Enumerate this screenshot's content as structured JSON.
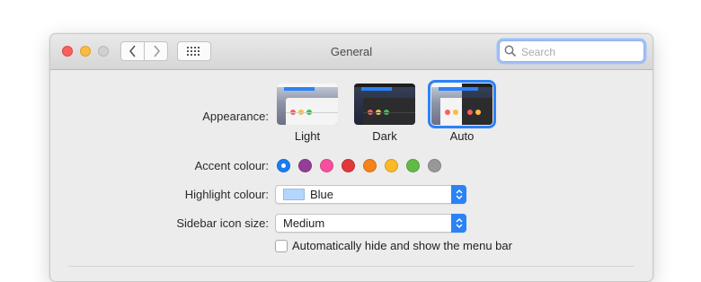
{
  "window": {
    "title": "General"
  },
  "toolbar": {
    "back_icon": "chevron-left-icon",
    "forward_icon": "chevron-right-icon",
    "grid_icon": "grid-icon",
    "search_placeholder": "Search",
    "search_value": ""
  },
  "appearance": {
    "label": "Appearance:",
    "options": [
      {
        "name": "Light",
        "selected": false
      },
      {
        "name": "Dark",
        "selected": false
      },
      {
        "name": "Auto",
        "selected": true
      }
    ]
  },
  "accent": {
    "label": "Accent colour:",
    "colors": [
      "#1a7cf5",
      "#953d96",
      "#f74f9e",
      "#e0383e",
      "#f7821b",
      "#fcb827",
      "#62ba46",
      "#989898"
    ],
    "selected_index": 0
  },
  "highlight": {
    "label": "Highlight colour:",
    "value": "Blue",
    "swatch": "#b3d6ff"
  },
  "sidebar_icon_size": {
    "label": "Sidebar icon size:",
    "value": "Medium"
  },
  "menu_bar": {
    "label": "Automatically hide and show the menu bar",
    "checked": false
  },
  "colors": {
    "accent_blue": "#2b82f7",
    "close": "#fc605c",
    "minimize": "#fdbc40",
    "zoom_disabled": "#d0d0d0"
  }
}
